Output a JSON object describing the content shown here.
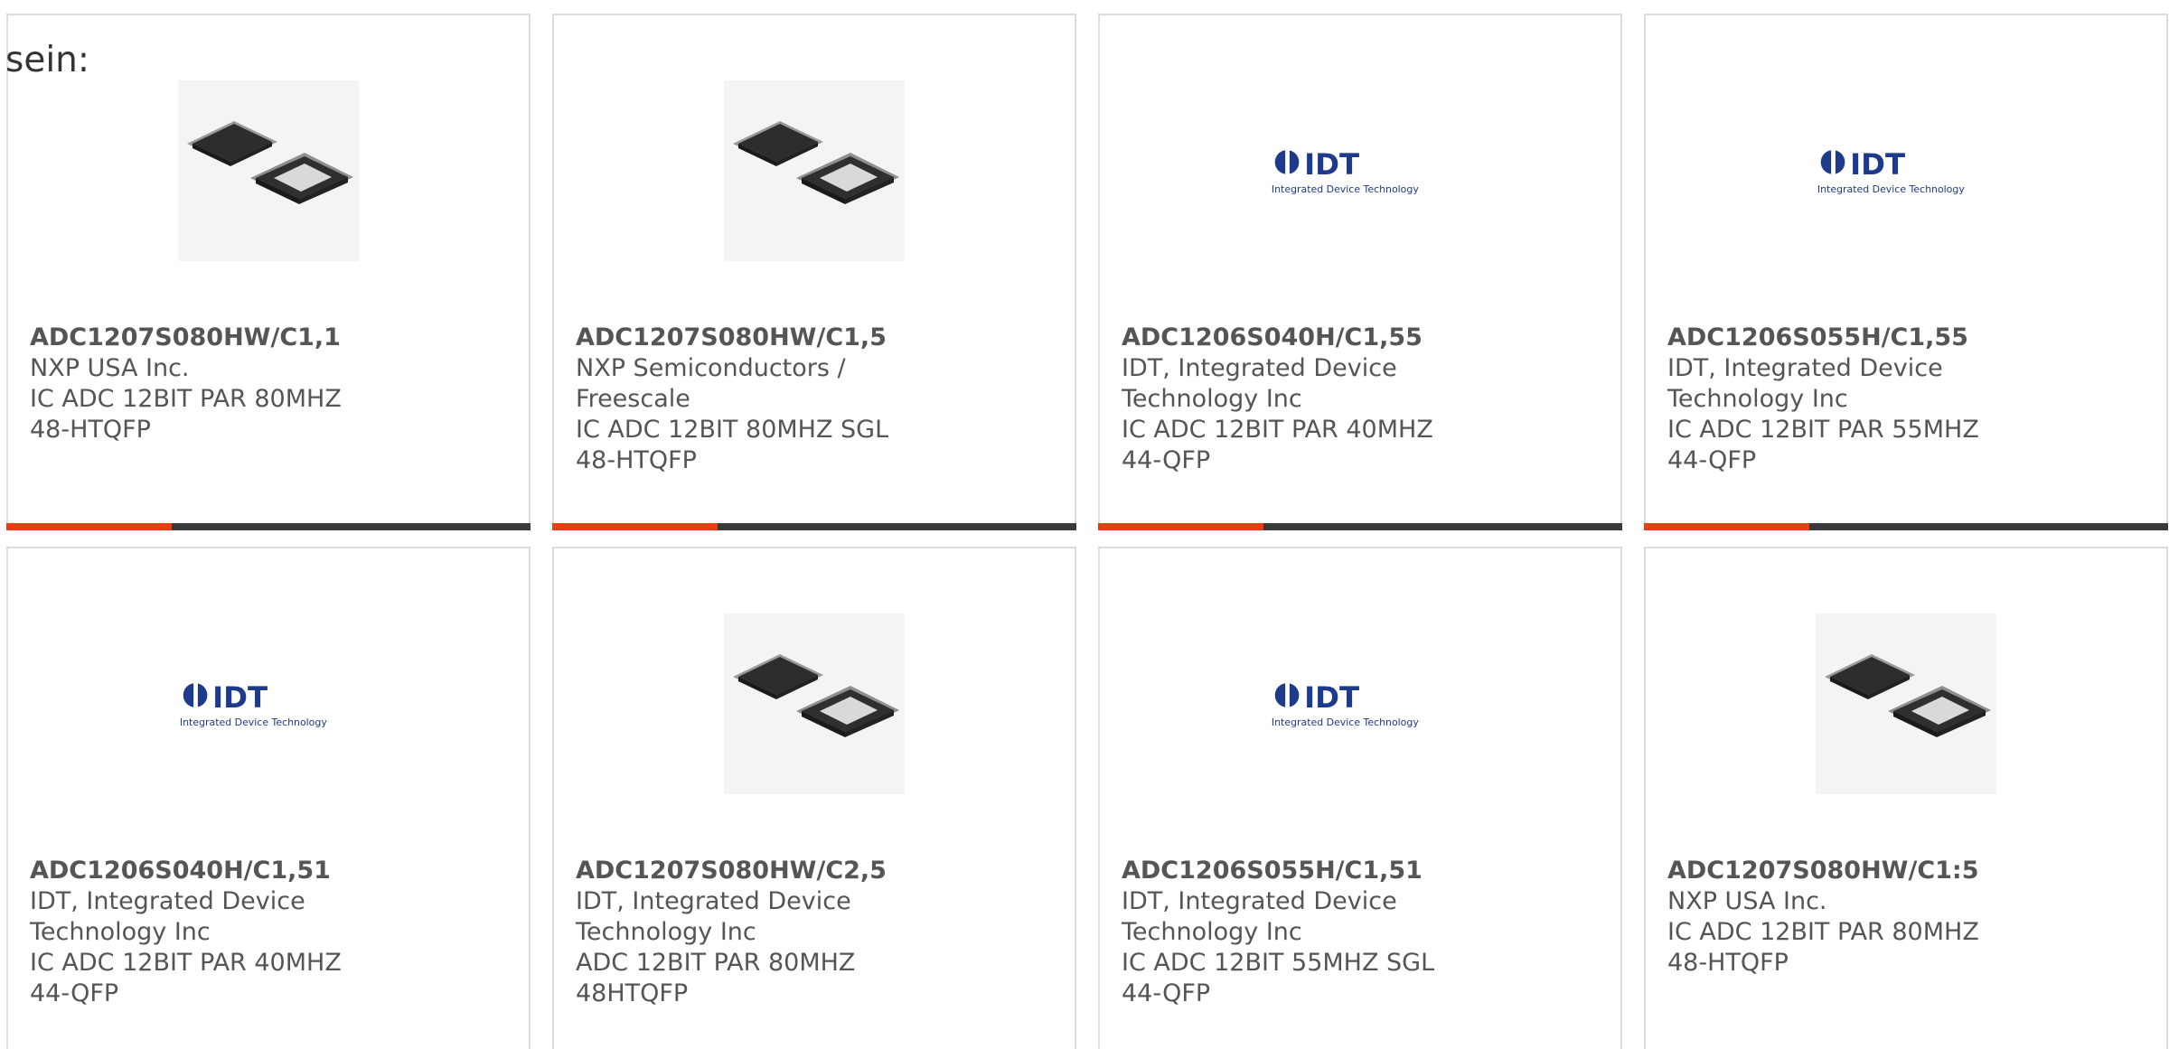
{
  "intro_text": "sein:",
  "colors": {
    "accent": "#ec3b13",
    "bar": "#3a3a3a",
    "idt_blue": "#1e3a8a"
  },
  "products": [
    {
      "part": "ADC1207S080HW/C1,1",
      "maker": "NXP USA Inc.",
      "desc": "IC ADC 12BIT PAR 80MHZ 48-HTQFP",
      "image": "chip-image"
    },
    {
      "part": "ADC1207S080HW/C1,5",
      "maker": "NXP Semiconductors / Freescale",
      "desc": "IC ADC 12BIT 80MHZ SGL 48-HTQFP",
      "image": "chip-image"
    },
    {
      "part": "ADC1206S040H/C1,55",
      "maker": "IDT, Integrated Device Technology Inc",
      "desc": "IC ADC 12BIT PAR 40MHZ 44-QFP",
      "image": "idt-logo"
    },
    {
      "part": "ADC1206S055H/C1,55",
      "maker": "IDT, Integrated Device Technology Inc",
      "desc": "IC ADC 12BIT PAR 55MHZ 44-QFP",
      "image": "idt-logo"
    },
    {
      "part": "ADC1206S040H/C1,51",
      "maker": "IDT, Integrated Device Technology Inc",
      "desc": "IC ADC 12BIT PAR 40MHZ 44-QFP",
      "image": "idt-logo"
    },
    {
      "part": "ADC1207S080HW/C2,5",
      "maker": "IDT, Integrated Device Technology Inc",
      "desc": "ADC 12BIT PAR 80MHZ 48HTQFP",
      "image": "chip-image"
    },
    {
      "part": "ADC1206S055H/C1,51",
      "maker": "IDT, Integrated Device Technology Inc",
      "desc": "IC ADC 12BIT 55MHZ SGL 44-QFP",
      "image": "idt-logo"
    },
    {
      "part": "ADC1207S080HW/C1:5",
      "maker": "NXP USA Inc.",
      "desc": "IC ADC 12BIT PAR 80MHZ 48-HTQFP",
      "image": "chip-image"
    }
  ],
  "idt_logo": {
    "wordmark": "IDT",
    "tagline": "Integrated Device Technology"
  }
}
